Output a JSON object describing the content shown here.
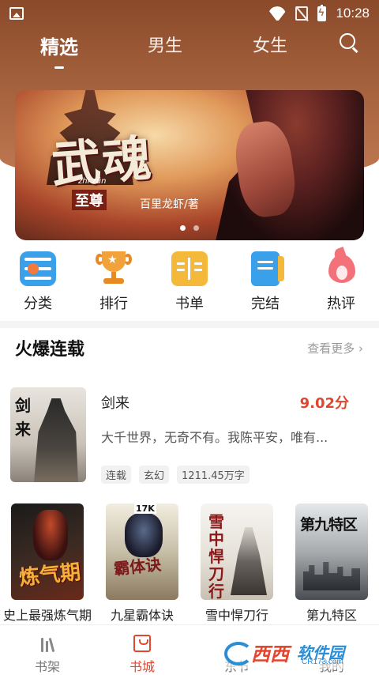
{
  "status_bar": {
    "time": "10:28"
  },
  "top_tabs": [
    {
      "label": "精选",
      "active": true
    },
    {
      "label": "男生",
      "active": false
    },
    {
      "label": "女生",
      "active": false
    }
  ],
  "banner": {
    "title": "武魂",
    "subtitle": "至尊",
    "pinyin": "zhì  zūn",
    "author": "百里龙虾/著",
    "dots": 2,
    "active_dot": 0
  },
  "categories": [
    {
      "label": "分类",
      "icon": "list-icon"
    },
    {
      "label": "排行",
      "icon": "trophy-icon"
    },
    {
      "label": "书单",
      "icon": "open-book-icon"
    },
    {
      "label": "完结",
      "icon": "closed-book-icon"
    },
    {
      "label": "热评",
      "icon": "flame-icon"
    }
  ],
  "section": {
    "title": "火爆连载",
    "more": "查看更多"
  },
  "featured": {
    "name": "剑来",
    "score": "9.02分",
    "description": "大千世界，无奇不有。我陈平安，唯有...",
    "cover_text": "剑来",
    "tags": [
      "连载",
      "玄幻",
      "1211.45万字"
    ]
  },
  "books": [
    {
      "name": "史上最强炼气期",
      "cover_text": "炼气期"
    },
    {
      "name": "九星霸体诀",
      "cover_text": "霸体诀",
      "cover_logo": "17K"
    },
    {
      "name": "雪中悍刀行",
      "cover_text": "雪中悍刀行"
    },
    {
      "name": "第九特区",
      "cover_text": "第九特区"
    }
  ],
  "bottom_nav": [
    {
      "label": "书架",
      "icon": "bookshelf-icon",
      "active": false
    },
    {
      "label": "书城",
      "icon": "shopping-bag-icon",
      "active": true
    },
    {
      "label": "东节",
      "icon": "",
      "active": false
    },
    {
      "label": "我的",
      "icon": "",
      "active": false
    }
  ],
  "watermark": {
    "brand": "西西",
    "brand2": "软件园",
    "url": "CR173.com"
  },
  "colors": {
    "accent": "#e0472e",
    "header": "#a3603c",
    "blue": "#3aa0ea",
    "orange": "#f4b93a"
  }
}
